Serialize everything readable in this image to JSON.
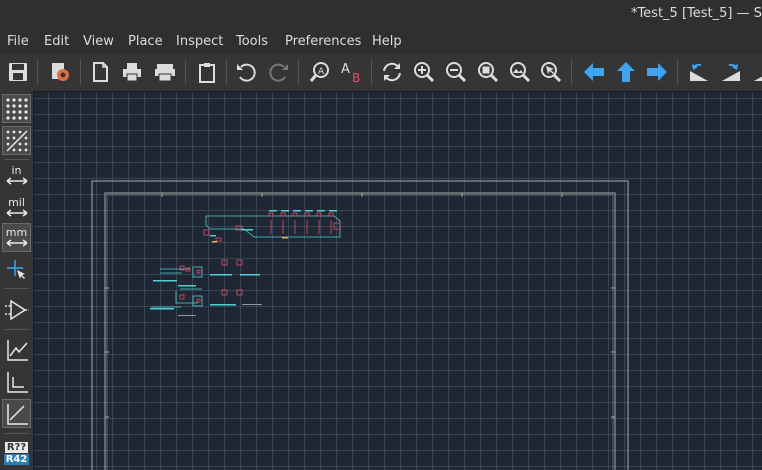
{
  "window": {
    "title": "*Test_5 [Test_5] — S"
  },
  "menu": {
    "file": "File",
    "edit": "Edit",
    "view": "View",
    "place": "Place",
    "inspect": "Inspect",
    "tools": "Tools",
    "preferences": "Preferences",
    "help": "Help"
  },
  "left_toolbar": {
    "units_in": "in",
    "units_mil": "mil",
    "units_mm": "mm",
    "annotate_top": "R??",
    "annotate_bottom": "R42"
  },
  "colors": {
    "canvas": "#1e2733",
    "grid": "#3a4553",
    "accent_blue": "#3ea3f0",
    "wire": "#4fd0d6",
    "component": "#e0506a"
  }
}
